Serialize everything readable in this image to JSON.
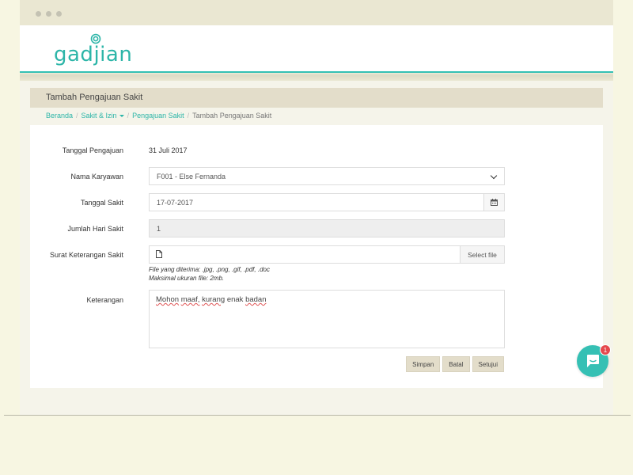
{
  "app": {
    "logo_text": "gadjian",
    "accent_color": "#35c0b4"
  },
  "page": {
    "title": "Tambah Pengajuan Sakit"
  },
  "breadcrumb": {
    "items": [
      "Beranda",
      "Sakit & Izin",
      "Pengajuan Sakit",
      "Tambah Pengajuan Sakit"
    ]
  },
  "form": {
    "tanggal_pengajuan": {
      "label": "Tanggal Pengajuan",
      "value": "31 Juli 2017"
    },
    "nama_karyawan": {
      "label": "Nama Karyawan",
      "value": "F001 - Else Fernanda",
      "icon": "chevron-down-icon"
    },
    "tanggal_sakit": {
      "label": "Tanggal Sakit",
      "value": "17-07-2017",
      "icon": "calendar-icon"
    },
    "jumlah_hari": {
      "label": "Jumlah Hari Sakit",
      "value": "1"
    },
    "surat": {
      "label": "Surat Keterangan Sakit",
      "button": "Select file",
      "icon": "file-icon",
      "help1": "File yang diterima: .jpg, .png, .gif, .pdf, .doc",
      "help2": "Maksimal ukuran file: 2mb."
    },
    "keterangan": {
      "label": "Keterangan",
      "words": [
        "Mohon",
        "maaf,",
        "kurang",
        "enak",
        "badan"
      ]
    }
  },
  "buttons": {
    "simpan": "Simpan",
    "batal": "Batal",
    "setujui": "Setujui"
  },
  "chat_widget": {
    "badge_count": "1",
    "icon": "chat-icon"
  }
}
